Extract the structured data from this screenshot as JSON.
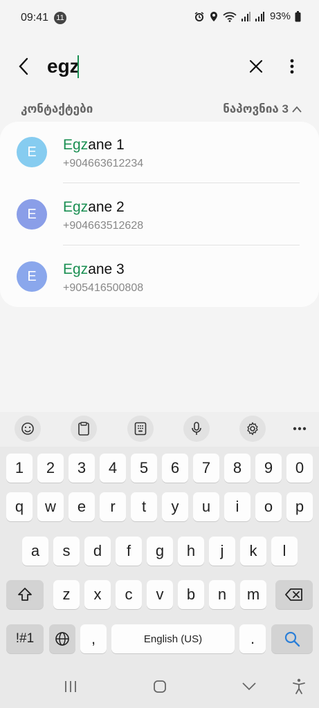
{
  "status_bar": {
    "time": "09:41",
    "notification_count": "11",
    "battery": "93%",
    "icons": [
      "alarm-icon",
      "location-icon",
      "wifi-icon",
      "signal-icon",
      "signal-icon",
      "battery-icon"
    ]
  },
  "search": {
    "query": "egz",
    "back_icon": "chevron-left-icon",
    "clear_icon": "close-icon",
    "more_icon": "more-vertical-icon"
  },
  "section": {
    "title": "კონტაქტები",
    "found_label": "ნაპოვნია 3",
    "collapse_icon": "chevron-up-icon"
  },
  "contacts": [
    {
      "initial": "E",
      "match": "Egz",
      "rest": "ane 1",
      "phone": "+904663612234",
      "avatar_color": "#86ccf0"
    },
    {
      "initial": "E",
      "match": "Egz",
      "rest": "ane 2",
      "phone": "+904663512628",
      "avatar_color": "#8a9ee8"
    },
    {
      "initial": "E",
      "match": "Egz",
      "rest": "ane 3",
      "phone": "+905416500808",
      "avatar_color": "#8aa7ec"
    }
  ],
  "keyboard_toolbar": [
    "emoji-icon",
    "clipboard-icon",
    "keypad-icon",
    "microphone-icon",
    "gear-icon",
    "more-horizontal-icon"
  ],
  "keyboard": {
    "row_numbers": [
      "1",
      "2",
      "3",
      "4",
      "5",
      "6",
      "7",
      "8",
      "9",
      "0"
    ],
    "row_1": [
      "q",
      "w",
      "e",
      "r",
      "t",
      "y",
      "u",
      "i",
      "o",
      "p"
    ],
    "row_2": [
      "a",
      "s",
      "d",
      "f",
      "g",
      "h",
      "j",
      "k",
      "l"
    ],
    "row_3": [
      "z",
      "x",
      "c",
      "v",
      "b",
      "n",
      "m"
    ],
    "symbols_label": "!#1",
    "comma_label": ",",
    "space_label": "English (US)",
    "period_label": ".",
    "shift_icon": "shift-icon",
    "backspace_icon": "backspace-icon",
    "language_icon": "globe-icon",
    "search_icon": "search-icon"
  },
  "nav_bar": [
    "recents-icon",
    "home-icon",
    "back-icon",
    "accessibility-icon"
  ],
  "colors": {
    "accent": "#1a8f52",
    "search_key": "#2b7fd8"
  }
}
